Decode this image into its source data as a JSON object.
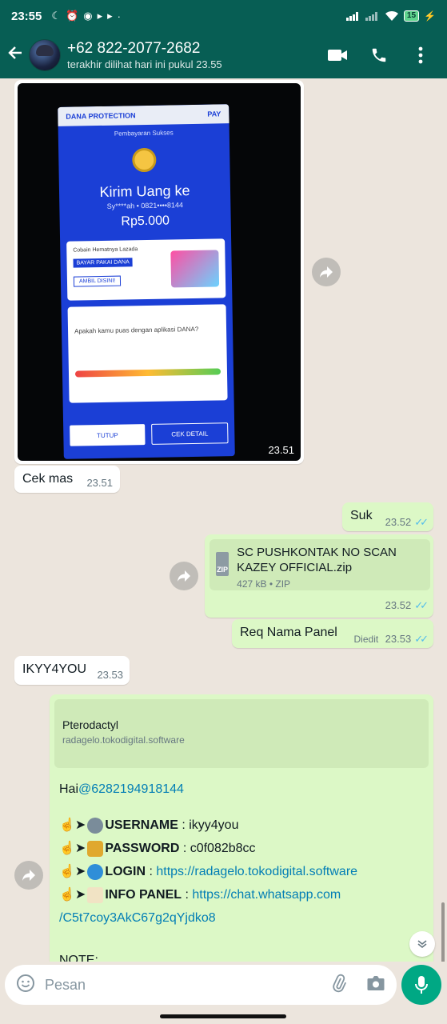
{
  "status_bar": {
    "time": "23:55",
    "battery": "15"
  },
  "header": {
    "contact_name": "+62 822-2077-2682",
    "last_seen": "terakhir dilihat hari ini pukul 23.55"
  },
  "messages": {
    "image": {
      "time": "23.51",
      "screenshot": {
        "brand_left": "DANA PROTECTION",
        "brand_right": "PAY",
        "subtitle": "Pembayaran Sukses",
        "title": "Kirim Uang ke",
        "account": "Sy****ah • 0821••••8144",
        "amount": "Rp5.000",
        "promo_text": "Cobain Hematnya Lazada",
        "promo_pay": "BAYAR PAKAI DANA",
        "promo_button": "AMBIL DISINI!",
        "survey_text": "Apakah kamu puas dengan aplikasi DANA?",
        "close_button": "TUTUP",
        "detail_button": "CEK DETAIL"
      }
    },
    "cek_mas": {
      "text": "Cek mas",
      "time": "23.51"
    },
    "suk": {
      "text": "Suk",
      "time": "23.52"
    },
    "file": {
      "name": "SC PUSHKONTAK NO SCAN KAZEY OFFICIAL.zip",
      "meta": "427 kB • ZIP",
      "icon_label": "ZIP",
      "time": "23.52"
    },
    "req_panel": {
      "text": "Req Nama Panel",
      "edited": "Diedit",
      "time": "23.53"
    },
    "ikyy": {
      "text": "IKYY4YOU",
      "time": "23.53"
    },
    "panel_info": {
      "preview_title": "Pterodactyl",
      "preview_url": "radagelo.tokodigital.software",
      "greeting": "Hai ",
      "mention": "@6282194918144",
      "arrow": "☝➤",
      "username_label": "USERNAME",
      "username_value": " : ikyy4you",
      "password_label": "PASSWORD",
      "password_value": " : c0f082b8cc",
      "login_label": "LOGIN",
      "login_sep": " : ",
      "login_link": "https://radagelo.tokodigital.software",
      "info_label": "INFO PANEL",
      "info_sep": " : ",
      "info_link_1": "https://chat.whatsapp.com",
      "info_link_2": "/C5t7coy3AkC67g2qYjdko8",
      "note": "NOTE:"
    }
  },
  "input": {
    "placeholder": "Pesan"
  },
  "colors": {
    "header": "#075e54",
    "outgoing": "#dcf8c6",
    "incoming": "#ffffff",
    "accent": "#00a884",
    "tick": "#53bdeb"
  },
  "icons": [
    "back-arrow-icon",
    "video-call-icon",
    "voice-call-icon",
    "more-options-icon",
    "forward-icon",
    "emoji-icon",
    "attach-icon",
    "camera-icon",
    "mic-icon",
    "chevron-down-icon"
  ]
}
